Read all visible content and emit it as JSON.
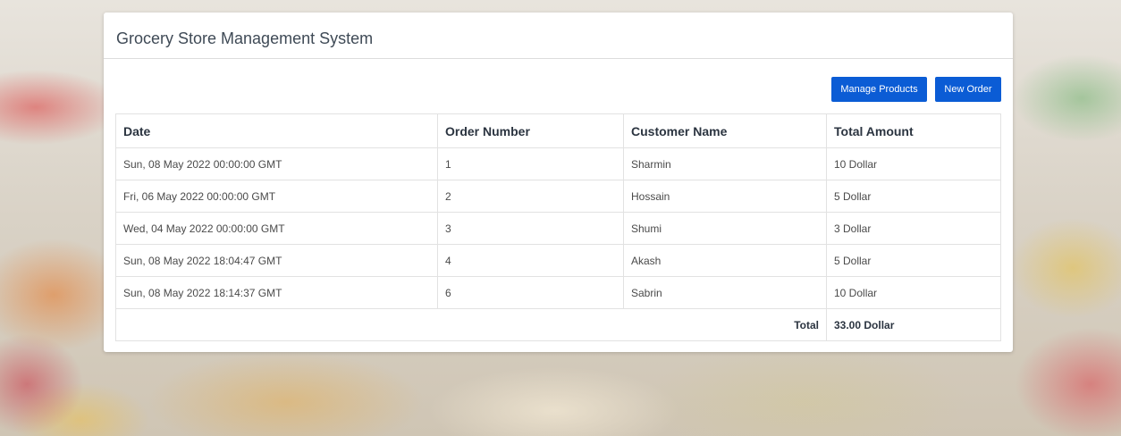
{
  "app": {
    "title": "Grocery Store Management System"
  },
  "toolbar": {
    "manage_products_label": "Manage Products",
    "new_order_label": "New Order"
  },
  "table": {
    "headers": [
      "Date",
      "Order Number",
      "Customer Name",
      "Total Amount"
    ],
    "rows": [
      [
        "Sun, 08 May 2022 00:00:00 GMT",
        "1",
        "Sharmin",
        "10 Dollar"
      ],
      [
        "Fri, 06 May 2022 00:00:00 GMT",
        "2",
        "Hossain",
        "5 Dollar"
      ],
      [
        "Wed, 04 May 2022 00:00:00 GMT",
        "3",
        "Shumi",
        "3 Dollar"
      ],
      [
        "Sun, 08 May 2022 18:04:47 GMT",
        "4",
        "Akash",
        "5 Dollar"
      ],
      [
        "Sun, 08 May 2022 18:14:37 GMT",
        "6",
        "Sabrin",
        "10 Dollar"
      ]
    ],
    "total_label": "Total",
    "total_value": "33.00 Dollar"
  },
  "colors": {
    "button": "#0b5cd5",
    "title_text": "#3f4a56"
  }
}
